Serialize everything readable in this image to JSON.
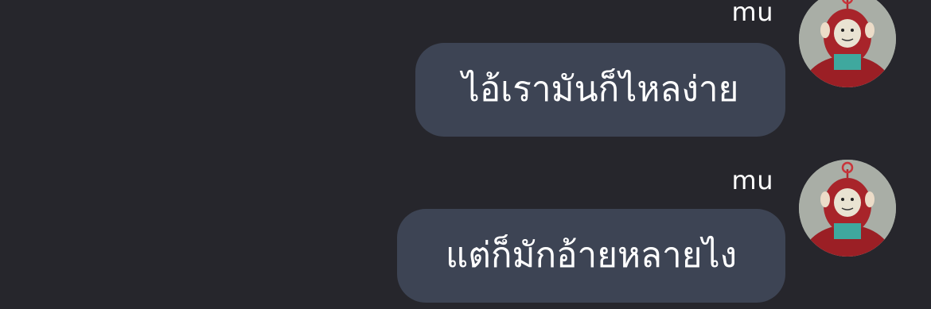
{
  "messages": [
    {
      "sender": "mu",
      "text": "ไอ้เรามันก็ไหลง่าย",
      "avatar_icon": "teletubby-po-avatar"
    },
    {
      "sender": "mu",
      "text": "แต่ก็มักอ้ายหลายไง",
      "avatar_icon": "teletubby-po-avatar"
    }
  ],
  "colors": {
    "background": "#26262c",
    "bubble": "#3d4454",
    "text": "#ffffff"
  }
}
